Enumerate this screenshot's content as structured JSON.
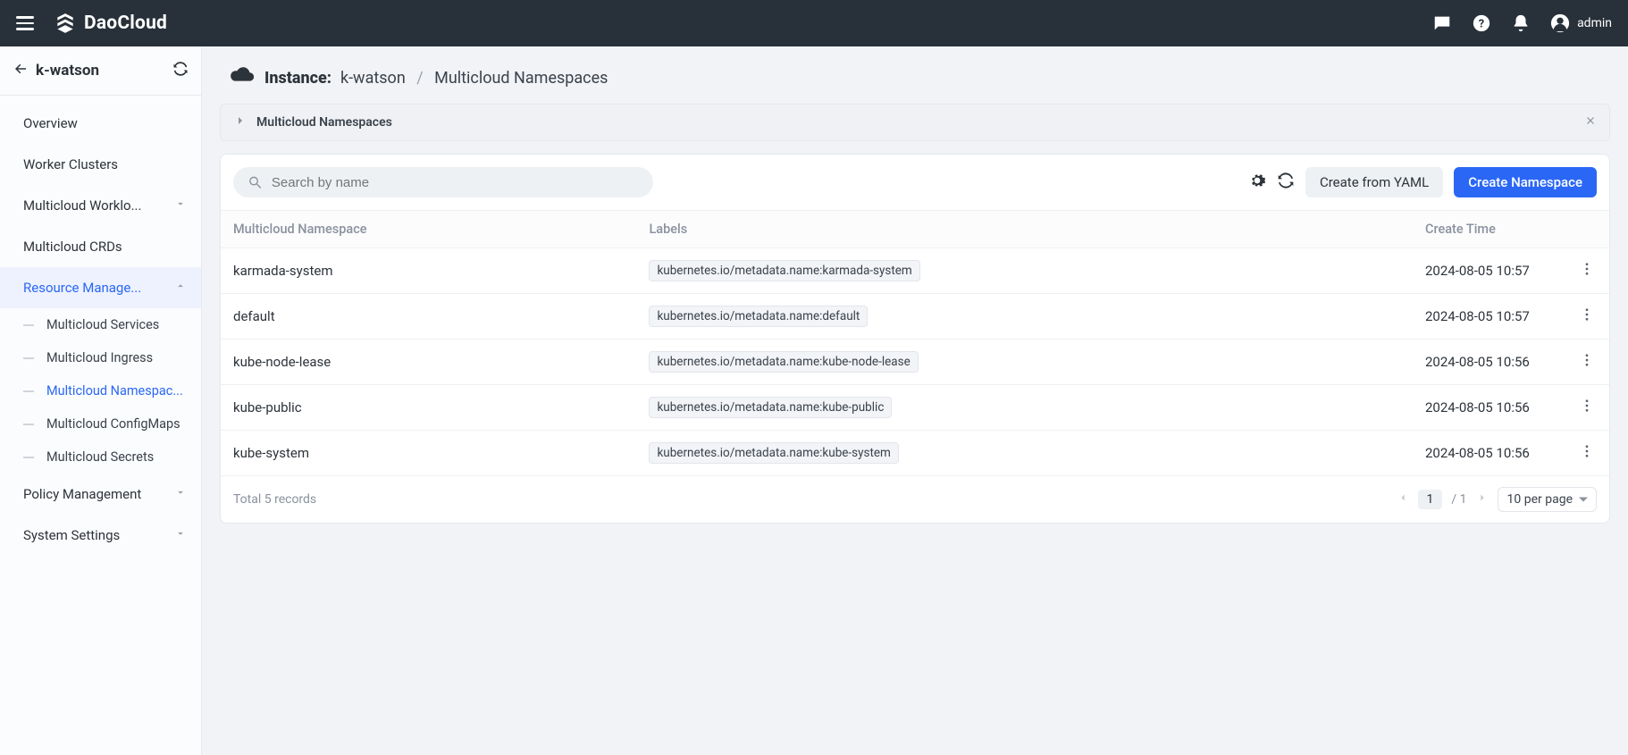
{
  "header": {
    "brand": "DaoCloud",
    "user": "admin"
  },
  "sidebar": {
    "context": "k-watson",
    "items": [
      {
        "label": "Overview"
      },
      {
        "label": "Worker Clusters"
      },
      {
        "label": "Multicloud Worklo...",
        "expandable": true
      },
      {
        "label": "Multicloud CRDs"
      },
      {
        "label": "Resource Manage...",
        "expandable": true,
        "active": true,
        "children": [
          {
            "label": "Multicloud Services"
          },
          {
            "label": "Multicloud Ingress"
          },
          {
            "label": "Multicloud Namespac...",
            "active": true
          },
          {
            "label": "Multicloud ConfigMaps"
          },
          {
            "label": "Multicloud Secrets"
          }
        ]
      },
      {
        "label": "Policy Management",
        "expandable": true
      },
      {
        "label": "System Settings",
        "expandable": true
      }
    ]
  },
  "breadcrumb": {
    "instance_label": "Instance:",
    "instance": "k-watson",
    "page": "Multicloud Namespaces"
  },
  "subhead": {
    "title": "Multicloud Namespaces"
  },
  "search": {
    "placeholder": "Search by name"
  },
  "buttons": {
    "yaml": "Create from YAML",
    "create": "Create Namespace"
  },
  "table": {
    "columns": [
      "Multicloud Namespace",
      "Labels",
      "Create Time"
    ],
    "rows": [
      {
        "name": "karmada-system",
        "label": "kubernetes.io/metadata.name:karmada-system",
        "time": "2024-08-05 10:57"
      },
      {
        "name": "default",
        "label": "kubernetes.io/metadata.name:default",
        "time": "2024-08-05 10:57"
      },
      {
        "name": "kube-node-lease",
        "label": "kubernetes.io/metadata.name:kube-node-lease",
        "time": "2024-08-05 10:56"
      },
      {
        "name": "kube-public",
        "label": "kubernetes.io/metadata.name:kube-public",
        "time": "2024-08-05 10:56"
      },
      {
        "name": "kube-system",
        "label": "kubernetes.io/metadata.name:kube-system",
        "time": "2024-08-05 10:56"
      }
    ]
  },
  "footer": {
    "total_label": "Total 5 records",
    "current_page": "1",
    "total_pages_label": "/ 1",
    "page_size_label": "10 per page"
  }
}
